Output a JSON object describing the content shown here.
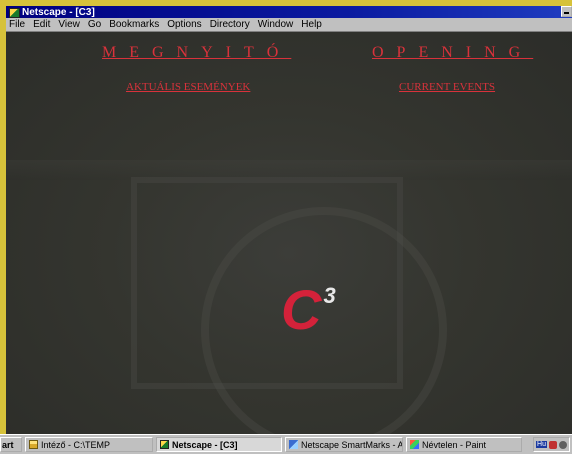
{
  "window": {
    "title": "Netscape - [C3]"
  },
  "menu": [
    "File",
    "Edit",
    "View",
    "Go",
    "Bookmarks",
    "Options",
    "Directory",
    "Window",
    "Help"
  ],
  "page": {
    "heading_hu": "MEGNYITÓ",
    "heading_en": "OPENING",
    "link_hu": "AKTUÁLIS ESEMÉNYEK",
    "link_en": "CURRENT EVENTS",
    "logo_main": "C",
    "logo_sup": "3",
    "accent_color": "#d8323b"
  },
  "taskbar": {
    "start_label": "art",
    "tasks": [
      {
        "label": "Intéző - C:\\TEMP",
        "icon": "folder-icon"
      },
      {
        "label": "Netscape - [C3]",
        "icon": "netscape-icon",
        "active": true
      },
      {
        "label": "Netscape SmartMarks - A...",
        "icon": "smartmarks-icon"
      },
      {
        "label": "Névtelen - Paint",
        "icon": "paint-icon"
      }
    ],
    "tray_lang": "Hu"
  }
}
